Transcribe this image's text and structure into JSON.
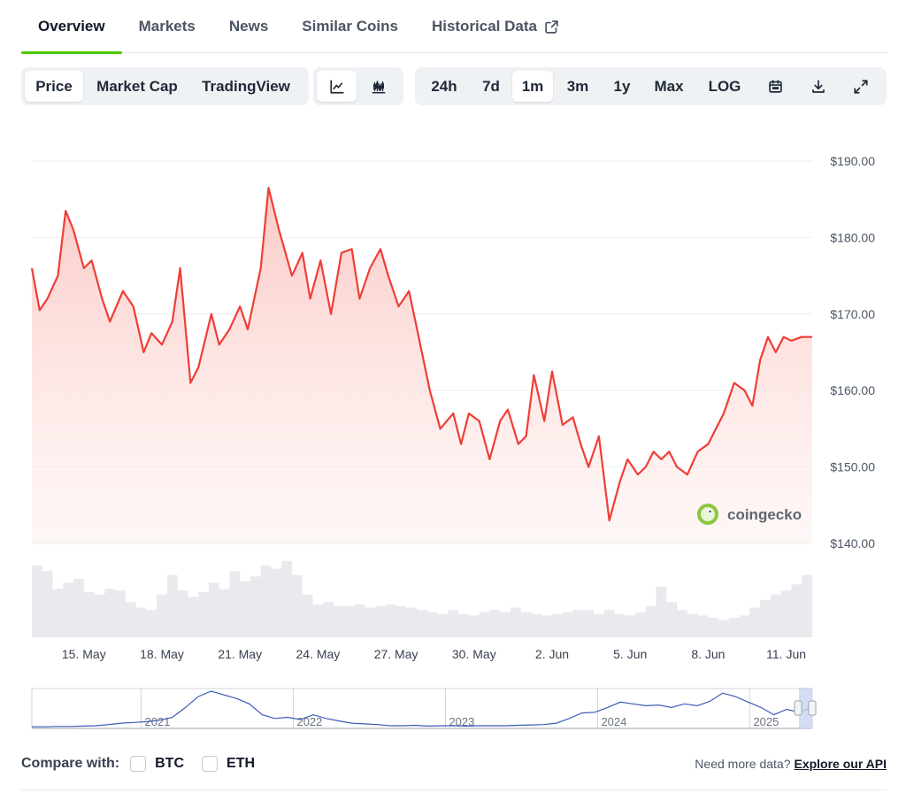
{
  "tabs": [
    {
      "label": "Overview",
      "active": true
    },
    {
      "label": "Markets"
    },
    {
      "label": "News"
    },
    {
      "label": "Similar Coins"
    },
    {
      "label": "Historical Data",
      "external": true
    }
  ],
  "toolbar": {
    "chart_types": [
      "Price",
      "Market Cap",
      "TradingView"
    ],
    "active_chart_type": "Price",
    "view_icons": [
      "line-chart-icon",
      "candlestick-icon"
    ],
    "ranges": [
      "24h",
      "7d",
      "1m",
      "3m",
      "1y",
      "Max",
      "LOG"
    ],
    "active_range": "1m",
    "tool_icons": [
      "calendar-icon",
      "download-icon",
      "expand-icon"
    ]
  },
  "watermark": "coingecko",
  "chart_data": {
    "type": "area",
    "line_color": "#ef3e36",
    "fill_color": "#fcd4d1",
    "volume_color": "#e4e6eb",
    "y_ticks": [
      190,
      180,
      170,
      160,
      150,
      140
    ],
    "y_tick_labels": [
      "$190.00",
      "$180.00",
      "$170.00",
      "$160.00",
      "$150.00",
      "$140.00"
    ],
    "ylim": [
      140,
      190
    ],
    "x_ticks": [
      "15. May",
      "18. May",
      "21. May",
      "24. May",
      "27. May",
      "30. May",
      "2. Jun",
      "5. Jun",
      "8. Jun",
      "11. Jun"
    ],
    "x_tick_days": [
      2,
      5,
      8,
      11,
      14,
      17,
      20,
      23,
      26,
      29
    ],
    "xlim": [
      0,
      30
    ],
    "grid": "horizontal",
    "series": [
      {
        "x": [
          0,
          0.3,
          0.6,
          1,
          1.3,
          1.6,
          2.0,
          2.3,
          2.7,
          3.0,
          3.5,
          3.9,
          4.3,
          4.6,
          5.0,
          5.4,
          5.7,
          6.1,
          6.4,
          6.9,
          7.2,
          7.6,
          8.0,
          8.3,
          8.8,
          9.1,
          9.5,
          10.0,
          10.4,
          10.7,
          11.1,
          11.5,
          11.9,
          12.3,
          12.6,
          13.0,
          13.4,
          13.7,
          14.1,
          14.5,
          14.9,
          15.3,
          15.7,
          16.2,
          16.5,
          16.8,
          17.2,
          17.6,
          18.0,
          18.3,
          18.7,
          19.0,
          19.3,
          19.7,
          20.0,
          20.4,
          20.8,
          21.1,
          21.4,
          21.8,
          22.2,
          22.6,
          22.9,
          23.3,
          23.6,
          23.9,
          24.2,
          24.5,
          24.8,
          25.2,
          25.6,
          26.0,
          26.3,
          26.6,
          27.0,
          27.4,
          27.7,
          28.0,
          28.3,
          28.6,
          28.9,
          29.2,
          29.6,
          30.0
        ],
        "y": [
          176,
          170.5,
          172,
          175,
          183.5,
          181,
          176,
          177,
          172,
          169,
          173,
          171,
          165,
          167.5,
          166,
          169,
          176,
          161,
          163,
          170,
          166,
          168,
          171,
          168,
          176,
          186.5,
          181,
          175,
          178,
          172,
          177,
          170,
          178,
          178.5,
          172,
          176,
          178.5,
          175,
          171,
          173,
          166.5,
          160,
          155,
          157,
          153,
          157,
          156,
          151,
          156,
          157.5,
          153,
          154,
          162,
          156,
          162.5,
          155.5,
          156.5,
          153,
          150,
          154,
          143,
          148,
          151,
          149,
          150,
          152,
          151,
          152,
          150,
          149,
          152,
          153,
          155,
          157,
          161,
          160,
          158,
          164,
          167,
          165,
          167,
          166.5,
          167,
          167
        ]
      }
    ],
    "volume": [
      0.92,
      0.85,
      0.62,
      0.7,
      0.75,
      0.58,
      0.55,
      0.62,
      0.6,
      0.45,
      0.38,
      0.35,
      0.55,
      0.8,
      0.6,
      0.52,
      0.58,
      0.7,
      0.62,
      0.85,
      0.72,
      0.78,
      0.92,
      0.88,
      0.98,
      0.8,
      0.55,
      0.42,
      0.45,
      0.4,
      0.4,
      0.42,
      0.38,
      0.4,
      0.42,
      0.4,
      0.38,
      0.35,
      0.32,
      0.3,
      0.35,
      0.3,
      0.28,
      0.32,
      0.35,
      0.32,
      0.38,
      0.32,
      0.3,
      0.28,
      0.3,
      0.32,
      0.35,
      0.35,
      0.3,
      0.35,
      0.3,
      0.28,
      0.32,
      0.4,
      0.65,
      0.45,
      0.35,
      0.3,
      0.28,
      0.25,
      0.22,
      0.25,
      0.28,
      0.38,
      0.48,
      0.55,
      0.6,
      0.68,
      0.8
    ],
    "navigator": {
      "year_labels": [
        "2021",
        "2022",
        "2023",
        "2024",
        "2025"
      ],
      "year_positions": [
        0.14,
        0.335,
        0.53,
        0.725,
        0.92
      ],
      "line_color": "#3b5cb8",
      "values": [
        0.02,
        0.02,
        0.03,
        0.03,
        0.04,
        0.05,
        0.08,
        0.12,
        0.14,
        0.16,
        0.2,
        0.28,
        0.55,
        0.85,
        1.0,
        0.9,
        0.8,
        0.65,
        0.35,
        0.25,
        0.28,
        0.22,
        0.35,
        0.25,
        0.18,
        0.12,
        0.1,
        0.08,
        0.05,
        0.05,
        0.06,
        0.04,
        0.05,
        0.05,
        0.04,
        0.05,
        0.05,
        0.05,
        0.06,
        0.07,
        0.08,
        0.12,
        0.25,
        0.4,
        0.42,
        0.55,
        0.7,
        0.65,
        0.6,
        0.62,
        0.55,
        0.65,
        0.6,
        0.72,
        0.95,
        0.85,
        0.7,
        0.55,
        0.35,
        0.5,
        0.42,
        0.55
      ]
    }
  },
  "footer": {
    "compare_label": "Compare with:",
    "compare_options": [
      "BTC",
      "ETH"
    ],
    "more_data_text": "Need more data?",
    "more_data_link": "Explore our API"
  }
}
